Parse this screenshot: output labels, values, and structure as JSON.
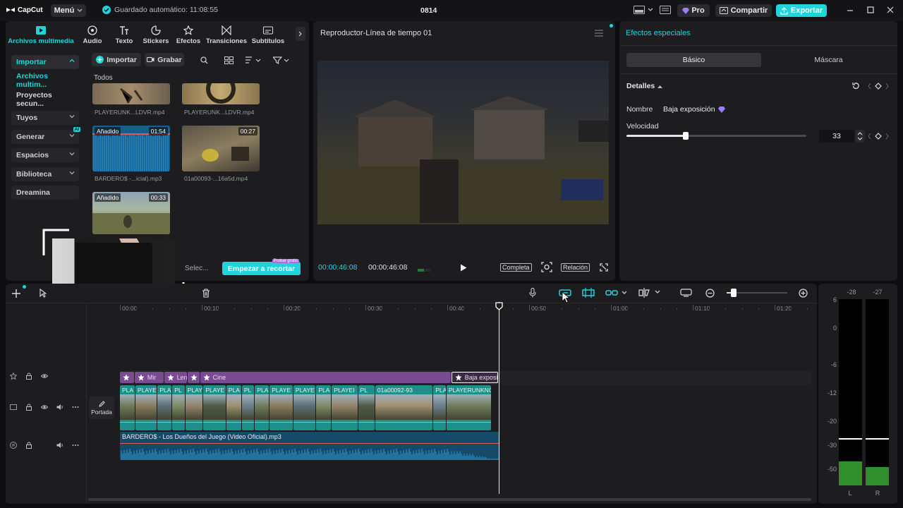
{
  "app": {
    "logo": "CapCut",
    "menu_label": "Menú",
    "autosave": "Guardado automático: 11:08:55",
    "project_title": "0814"
  },
  "titlebar": {
    "pro_label": "Pro",
    "share_label": "Compartir",
    "export_label": "Exportar"
  },
  "top_tabs": [
    {
      "label": "Archivos multimedia",
      "icon": "media-icon"
    },
    {
      "label": "Audio",
      "icon": "audio-icon"
    },
    {
      "label": "Texto",
      "icon": "text-icon"
    },
    {
      "label": "Stickers",
      "icon": "sticker-icon"
    },
    {
      "label": "Efectos",
      "icon": "effects-icon"
    },
    {
      "label": "Transiciones",
      "icon": "transitions-icon"
    },
    {
      "label": "Subtítulos",
      "icon": "subtitles-icon"
    }
  ],
  "sidebar": {
    "items": [
      {
        "label": "Importar"
      },
      {
        "label": "Archivos multim..."
      },
      {
        "label": "Proyectos secun..."
      },
      {
        "label": "Tuyos"
      },
      {
        "label": "Generar",
        "badge": "AI"
      },
      {
        "label": "Espacios"
      },
      {
        "label": "Biblioteca"
      },
      {
        "label": "Dreamina"
      }
    ]
  },
  "media": {
    "import_label": "Importar",
    "record_label": "Grabar",
    "section_label": "Todos",
    "items": [
      {
        "name": "PLAYERUNK...LDVR.mp4"
      },
      {
        "name": "PLAYERUNK...LDVR.mp4"
      },
      {
        "name": "BARDERO$ -...icial).mp3",
        "added": "Añadido",
        "duration": "01:54"
      },
      {
        "name": "01a00093-...16a5d.mp4",
        "duration": "00:27"
      },
      {
        "name": "",
        "added": "Añadido",
        "duration": "00:33"
      }
    ],
    "select_label": "Selec...",
    "cut_button": "Empezar a recortar",
    "cut_badge": "Probar gratis"
  },
  "player": {
    "title": "Reproductor-Línea de tiempo 01",
    "current_time": "00:00:46:08",
    "total_time": "00:00:46:08",
    "full_label": "Completa",
    "ratio_label": "Relación"
  },
  "effects_panel": {
    "title": "Efectos especiales",
    "tab_basic": "Básico",
    "tab_mask": "Máscara",
    "details_label": "Detalles",
    "name_label": "Nombre",
    "name_value": "Baja exposición",
    "speed_label": "Velocidad",
    "speed_value": "33",
    "speed_fraction": 0.33
  },
  "timeline": {
    "ruler": [
      "00:00",
      "00:10",
      "00:20",
      "00:30",
      "00:40",
      "00:50",
      "01:00",
      "01:10",
      "01:20"
    ],
    "cover_label": "Portada",
    "effect_clips": [
      {
        "label": "",
        "start": 0,
        "end": 1.8
      },
      {
        "label": "Mir",
        "start": 1.8,
        "end": 5.4
      },
      {
        "label": "Len",
        "start": 5.4,
        "end": 8.3
      },
      {
        "label": "",
        "start": 8.3,
        "end": 9.8
      },
      {
        "label": "Cine",
        "start": 9.8,
        "end": 40.5
      },
      {
        "label": "Baja exposi",
        "start": 40.5,
        "end": 46.3
      }
    ],
    "video_clips": [
      {
        "label": "PLA",
        "dur": 1.9
      },
      {
        "label": "PLAYE",
        "dur": 2.7
      },
      {
        "label": "PLA",
        "dur": 1.8
      },
      {
        "label": "PL",
        "dur": 1.6
      },
      {
        "label": "PLAYE",
        "dur": 2.2
      },
      {
        "label": "PLAYE",
        "dur": 2.8
      },
      {
        "label": "PLA",
        "dur": 1.9
      },
      {
        "label": "PL",
        "dur": 1.6
      },
      {
        "label": "PLA",
        "dur": 1.8
      },
      {
        "label": "PLAYE",
        "dur": 2.9
      },
      {
        "label": "PLAYE",
        "dur": 2.8
      },
      {
        "label": "PLA",
        "dur": 1.9
      },
      {
        "label": "PLAYEI",
        "dur": 3.2
      },
      {
        "label": "PL",
        "dur": 2.1
      },
      {
        "label": "01a00092-93",
        "dur": 7.1
      },
      {
        "label": "PLA",
        "dur": 1.6
      },
      {
        "label": "PLAYERUNKNO",
        "dur": 5.5
      }
    ],
    "audio_clip": {
      "label": "BARDERO$ - Los Dueños del Juego (Video Oficial).mp3",
      "dur": 46.3
    },
    "playhead": 46.3
  },
  "meter": {
    "peak_left": "-28",
    "peak_right": "-27",
    "scale": [
      "6",
      "0",
      "-6",
      "-12",
      "-20",
      "-30",
      "-50"
    ],
    "channel_left": "L",
    "channel_right": "R"
  },
  "colors": {
    "accent": "#20d4dc",
    "pro": "#9c7bff",
    "effect": "#7a4a92",
    "video": "#1e8f8a",
    "audio": "#1b5f87"
  }
}
